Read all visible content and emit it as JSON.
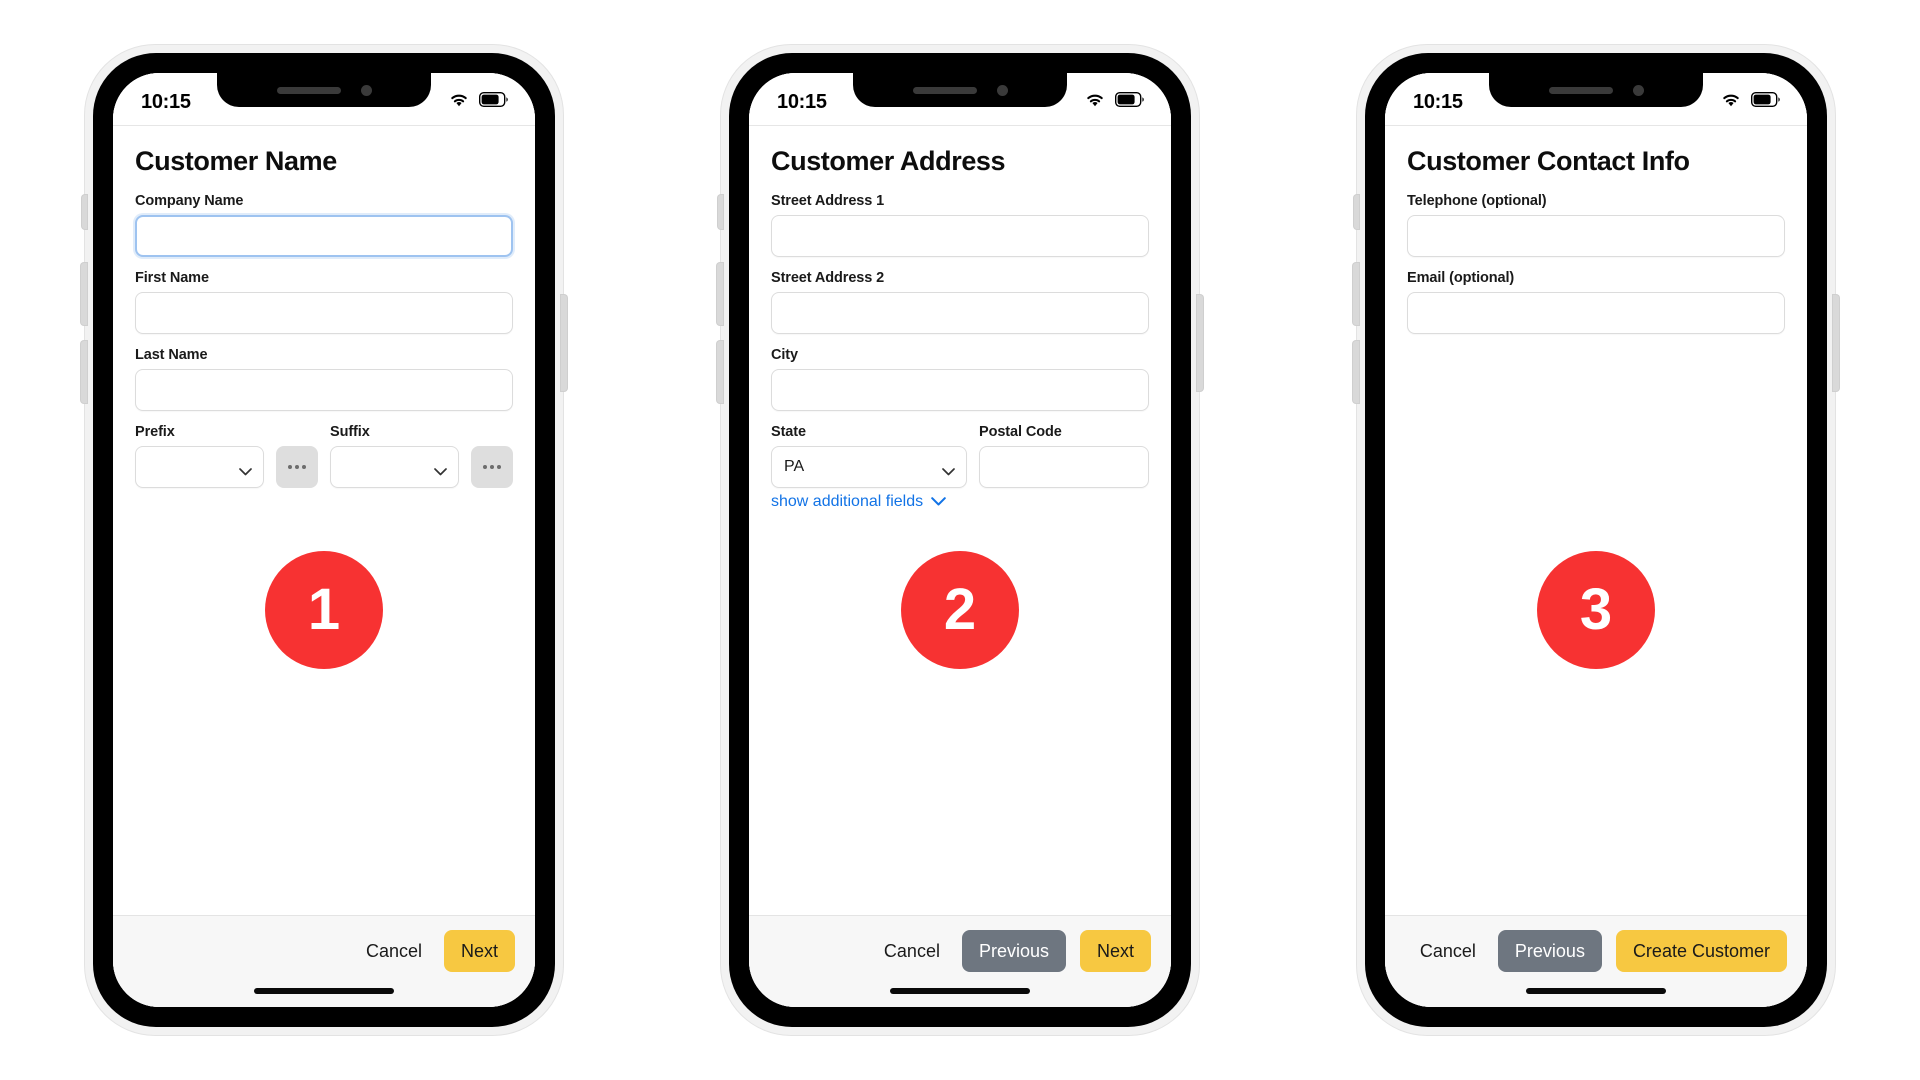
{
  "statusbar": {
    "time": "10:15",
    "wifi_icon": "wifi-icon",
    "battery_icon": "battery-icon"
  },
  "common": {
    "cancel_label": "Cancel",
    "previous_label": "Previous",
    "next_label": "Next"
  },
  "screens": [
    {
      "badge": "1",
      "title": "Customer Name",
      "fields": {
        "company_name_label": "Company Name",
        "company_name_value": "",
        "first_name_label": "First Name",
        "first_name_value": "",
        "last_name_label": "Last Name",
        "last_name_value": "",
        "prefix_label": "Prefix",
        "prefix_value": "",
        "suffix_label": "Suffix",
        "suffix_value": ""
      },
      "actions": {
        "cancel": "Cancel",
        "primary": "Next"
      }
    },
    {
      "badge": "2",
      "title": "Customer Address",
      "fields": {
        "street1_label": "Street Address 1",
        "street1_value": "",
        "street2_label": "Street Address 2",
        "street2_value": "",
        "city_label": "City",
        "city_value": "",
        "state_label": "State",
        "state_value": "PA",
        "postal_label": "Postal Code",
        "postal_value": "",
        "show_additional_label": "show additional fields"
      },
      "actions": {
        "cancel": "Cancel",
        "previous": "Previous",
        "primary": "Next"
      }
    },
    {
      "badge": "3",
      "title": "Customer Contact Info",
      "fields": {
        "telephone_label": "Telephone (optional)",
        "telephone_value": "",
        "email_label": "Email (optional)",
        "email_value": ""
      },
      "actions": {
        "cancel": "Cancel",
        "previous": "Previous",
        "primary": "Create Customer"
      }
    }
  ],
  "colors": {
    "badge_red": "#f73232",
    "primary_amber": "#f7c841",
    "secondary_gray": "#6e7680",
    "link_blue": "#1273e6"
  }
}
